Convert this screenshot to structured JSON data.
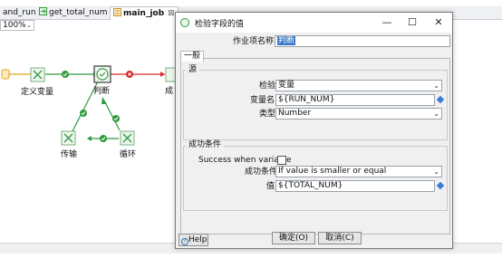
{
  "editor": {
    "tabs": [
      {
        "label": "and_run"
      },
      {
        "label": "get_total_num"
      },
      {
        "label": "main_job"
      }
    ],
    "zoom": "100%",
    "nodes": {
      "define_var": "定义变量",
      "judge": "判断",
      "transfer": "传输",
      "loop": "循环",
      "success_partial": "成"
    }
  },
  "dialog": {
    "title": "检验字段的值",
    "job_name_label": "作业项名称:",
    "job_name_value": "判断",
    "general_tab": "一般",
    "source_group": "源",
    "check_label": "检验",
    "check_value": "变量",
    "varname_label": "变量名",
    "varname_value": "${RUN_NUM}",
    "type_label": "类型",
    "type_value": "Number",
    "success_group": "成功条件",
    "success_when_label": "Success when variable",
    "success_condition_label": "成功条件",
    "success_condition_value": "If value is smaller or equal",
    "value_label": "值",
    "value_value": "${TOTAL_NUM}",
    "help_button": "Help",
    "ok_button": "确定(O)",
    "cancel_button": "取消(C)"
  },
  "colors": {
    "success_green": "#2e9b3e",
    "error_red": "#d62b2b",
    "variable_diamond": "#3a7bd5",
    "selection_blue": "#3b78c8"
  }
}
